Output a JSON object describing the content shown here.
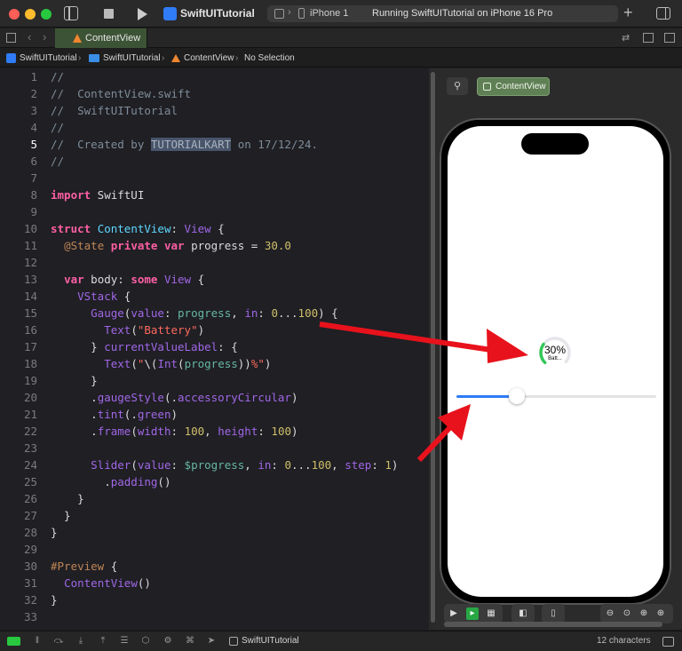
{
  "window": {
    "app_name": "SwiftUITutorial",
    "device_name": "iPhone 1",
    "run_status": "Running SwiftUITutorial on iPhone 16 Pro"
  },
  "tab": {
    "label": "ContentView"
  },
  "breadcrumb": {
    "project": "SwiftUITutorial",
    "group": "SwiftUITutorial",
    "file": "ContentView",
    "selection": "No Selection"
  },
  "editor": {
    "current_line": 5,
    "line_count": 33
  },
  "canvas": {
    "preview_label": "ContentView",
    "gauge": {
      "value_text": "30%",
      "label_text": "Batt...",
      "progress": 0.3,
      "tint": "#34c759"
    },
    "slider": {
      "value": 30,
      "min": 0,
      "max": 100,
      "tint": "#2f7cf6"
    }
  },
  "status_bar": {
    "scheme": "SwiftUITutorial",
    "char_count": "12 characters"
  },
  "colors": {
    "arrow": "#e8121c",
    "tab_active": "#3d5336",
    "preview_pill": "#5f7f55"
  },
  "icons": [
    "sidebar-icon",
    "stop-icon",
    "run-icon",
    "plus-icon",
    "inspector-icon",
    "grid-icon",
    "pin-icon",
    "zoom-out-icon",
    "zoom-in-icon",
    "zoom-fit-icon"
  ]
}
